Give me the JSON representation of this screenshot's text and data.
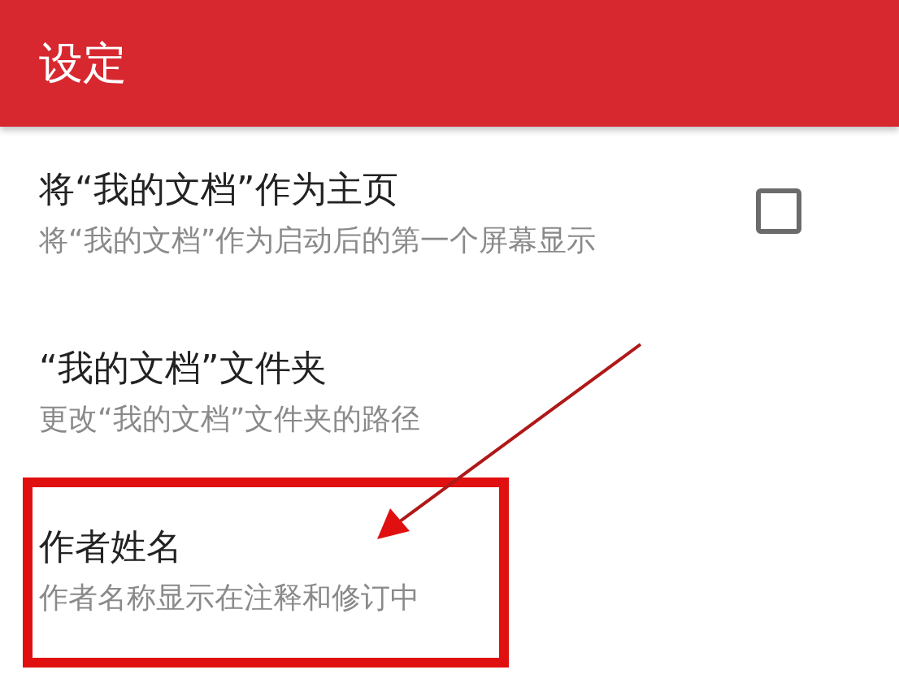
{
  "app_bar": {
    "title": "设定"
  },
  "settings": [
    {
      "kind": "checkbox",
      "title": "将“我的文档”作为主页",
      "summary": "将“我的文档”作为启动后的第一个屏幕显示",
      "checked": false
    },
    {
      "kind": "plain",
      "title": "“我的文档”文件夹",
      "summary": "更改“我的文档”文件夹的路径"
    },
    {
      "kind": "plain",
      "title": "作者姓名",
      "summary": "作者名称显示在注释和修订中"
    }
  ]
}
